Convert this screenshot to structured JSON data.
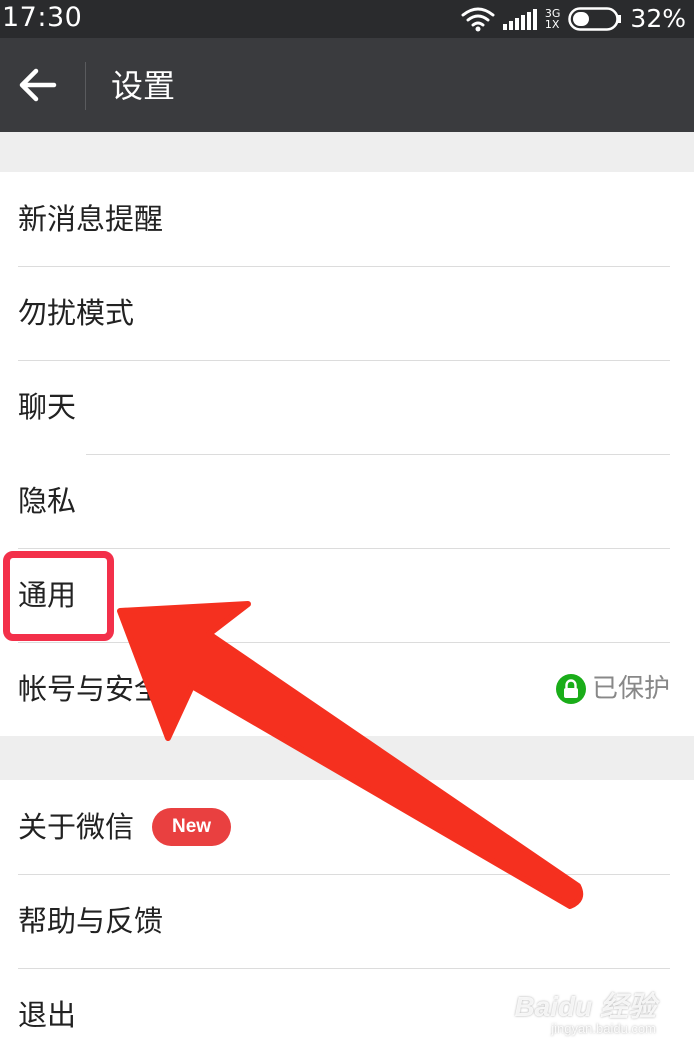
{
  "status_bar": {
    "time": "17:30",
    "network_top": "3G",
    "network_bottom": "1X",
    "battery_percent": "32%",
    "icons": [
      "wifi-icon",
      "signal-icon",
      "battery-icon"
    ]
  },
  "action_bar": {
    "title": "设置",
    "back_icon": "arrow-left-icon"
  },
  "settings_group_1": [
    {
      "label": "新消息提醒"
    },
    {
      "label": "勿扰模式"
    },
    {
      "label": "聊天"
    },
    {
      "label": "隐私"
    },
    {
      "label": "通用"
    },
    {
      "label": "帐号与安全",
      "status": "已保护",
      "status_icon": "lock-icon"
    }
  ],
  "settings_group_2": [
    {
      "label": "关于微信",
      "badge": "New"
    },
    {
      "label": "帮助与反馈"
    },
    {
      "label": "退出"
    }
  ],
  "watermark": {
    "brand": "Baidu 经验",
    "url": "jingyan.baidu.com"
  },
  "colors": {
    "status_bar_bg": "#2a2b2d",
    "action_bar_bg": "#3a3b3e",
    "page_bg": "#eeeeee",
    "accent_green": "#1aad19",
    "badge_red": "#e94040",
    "annotation_red": "#f3304a"
  }
}
